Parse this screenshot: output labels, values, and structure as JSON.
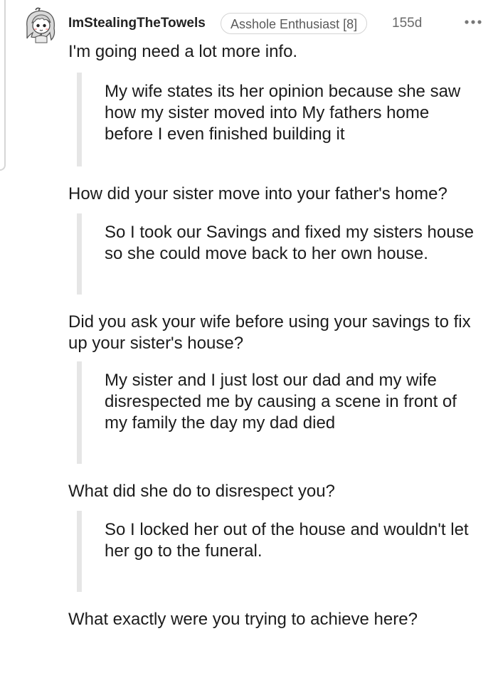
{
  "comment": {
    "username": "ImStealingTheTowels",
    "flair": "Asshole Enthusiast [8]",
    "age": "155d",
    "more_label": "•••",
    "blocks": [
      {
        "type": "paragraph",
        "text": "I'm going need a lot more info."
      },
      {
        "type": "quote",
        "text": "My wife states its her opinion because she saw how my sister moved into My fathers home before I even finished building it"
      },
      {
        "type": "paragraph",
        "text": "How did your sister move into your father's home?"
      },
      {
        "type": "quote",
        "text": "So I took our Savings and fixed my sisters house so she could move back to her own house."
      },
      {
        "type": "paragraph",
        "text": "Did you ask your wife before using your savings to fix up your sister's house?"
      },
      {
        "type": "quote",
        "text": "My sister and I just lost our dad and my wife disrespected me by causing a scene in front of my family the day my dad died"
      },
      {
        "type": "paragraph",
        "text": "What did she do to disrespect you?"
      },
      {
        "type": "quote",
        "text": "So I locked her out of the house and wouldn't let her go to the funeral."
      },
      {
        "type": "paragraph",
        "text": "What exactly were you trying to achieve here?"
      }
    ]
  },
  "icons": {
    "avatar": "snoo-avatar-icon",
    "more": "more-options-icon"
  }
}
